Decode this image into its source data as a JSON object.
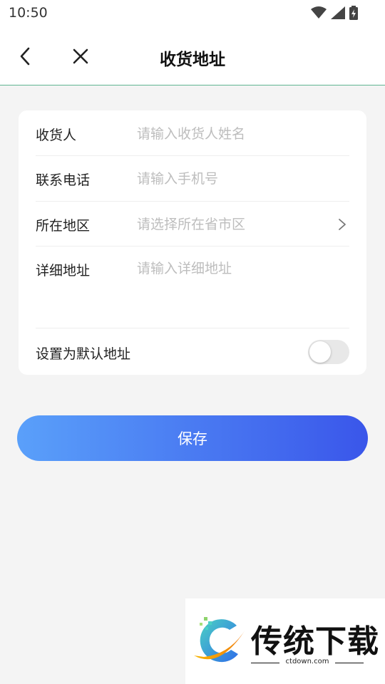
{
  "status_bar": {
    "time": "10:50"
  },
  "header": {
    "title": "收货地址"
  },
  "form": {
    "recipient": {
      "label": "收货人",
      "placeholder": "请输入收货人姓名"
    },
    "phone": {
      "label": "联系电话",
      "placeholder": "请输入手机号"
    },
    "region": {
      "label": "所在地区",
      "placeholder": "请选择所在省市区"
    },
    "address": {
      "label": "详细地址",
      "placeholder": "请输入详细地址"
    },
    "default": {
      "label": "设置为默认地址",
      "enabled": false
    }
  },
  "save_label": "保存",
  "watermark": {
    "title": "传统下载",
    "url": "ctdown.com"
  },
  "colors": {
    "accent_start": "#5aa0fa",
    "accent_end": "#3a56ea",
    "header_line": "#5fb592"
  }
}
